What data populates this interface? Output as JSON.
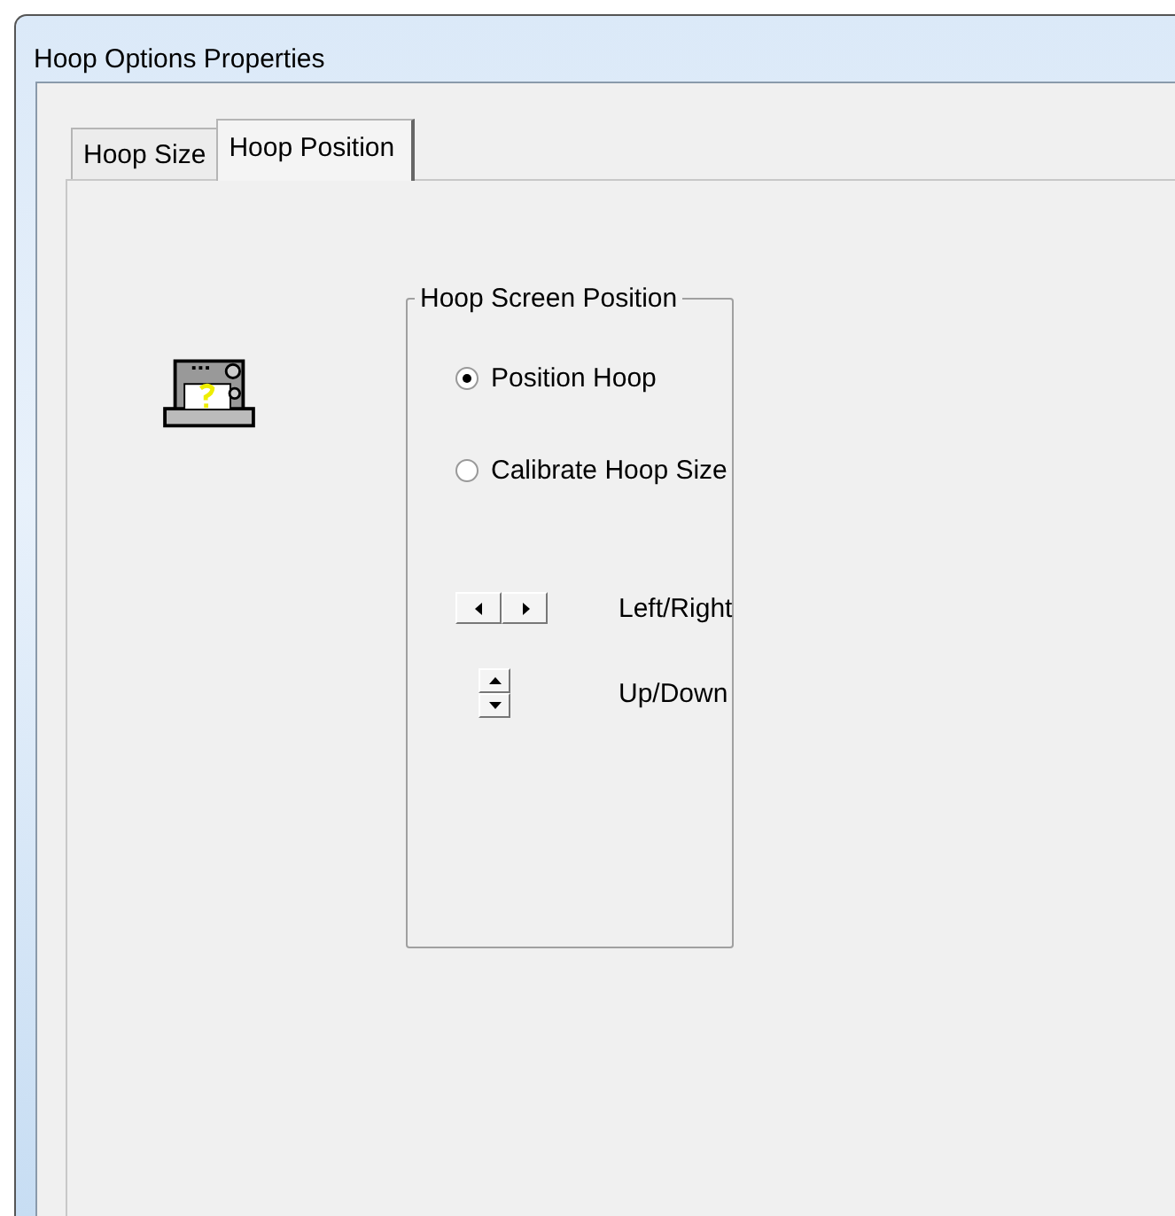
{
  "window": {
    "title": "Hoop Options Properties"
  },
  "tabs": [
    {
      "label": "Hoop Size",
      "selected": false
    },
    {
      "label": "Hoop Position",
      "selected": true
    }
  ],
  "group": {
    "title": "Hoop Screen Position",
    "options": [
      {
        "label": "Position Hoop",
        "selected": true
      },
      {
        "label": "Calibrate Hoop Size",
        "selected": false
      }
    ],
    "spinners": [
      {
        "kind": "horizontal",
        "label": "Left/Right"
      },
      {
        "kind": "vertical",
        "label": "Up/Down"
      }
    ]
  }
}
